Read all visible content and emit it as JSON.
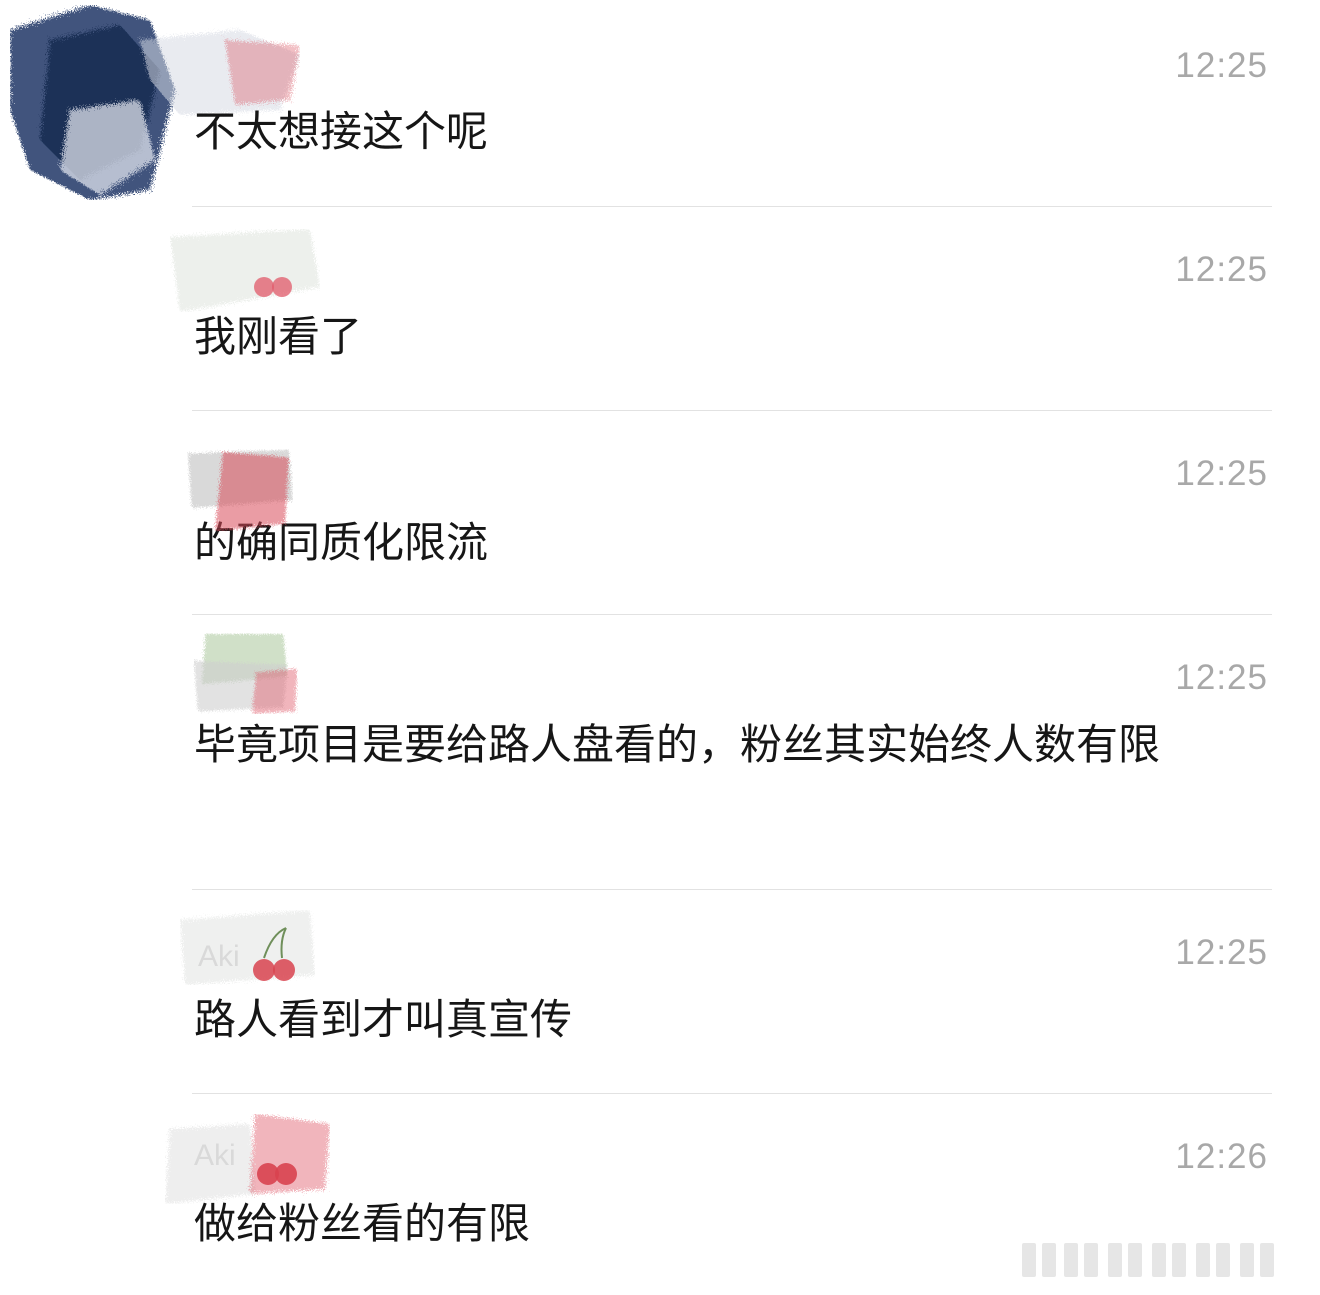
{
  "messages": [
    {
      "time": "12:25",
      "text": "不太想接这个呢"
    },
    {
      "time": "12:25",
      "text": "我刚看了"
    },
    {
      "time": "12:25",
      "text": "的确同质化限流"
    },
    {
      "time": "12:25",
      "text": "毕竟项目是要给路人盘看的，粉丝其实始终人数有限"
    },
    {
      "time": "12:25",
      "text": "路人看到才叫真宣传"
    },
    {
      "time": "12:26",
      "text": "做给粉丝看的有限"
    }
  ],
  "sender_labels": {
    "row5": "Aki",
    "row6": "Aki"
  },
  "colors": {
    "background": "#ffffff",
    "divider": "#e2e2e2",
    "time_text": "#a8a8a8",
    "message_text": "#161616",
    "scribble_navy": "#1c3566",
    "scribble_red": "#d94a5a"
  },
  "icons": [
    "cherry-icon",
    "avatar-scribble",
    "watermark-bars"
  ]
}
